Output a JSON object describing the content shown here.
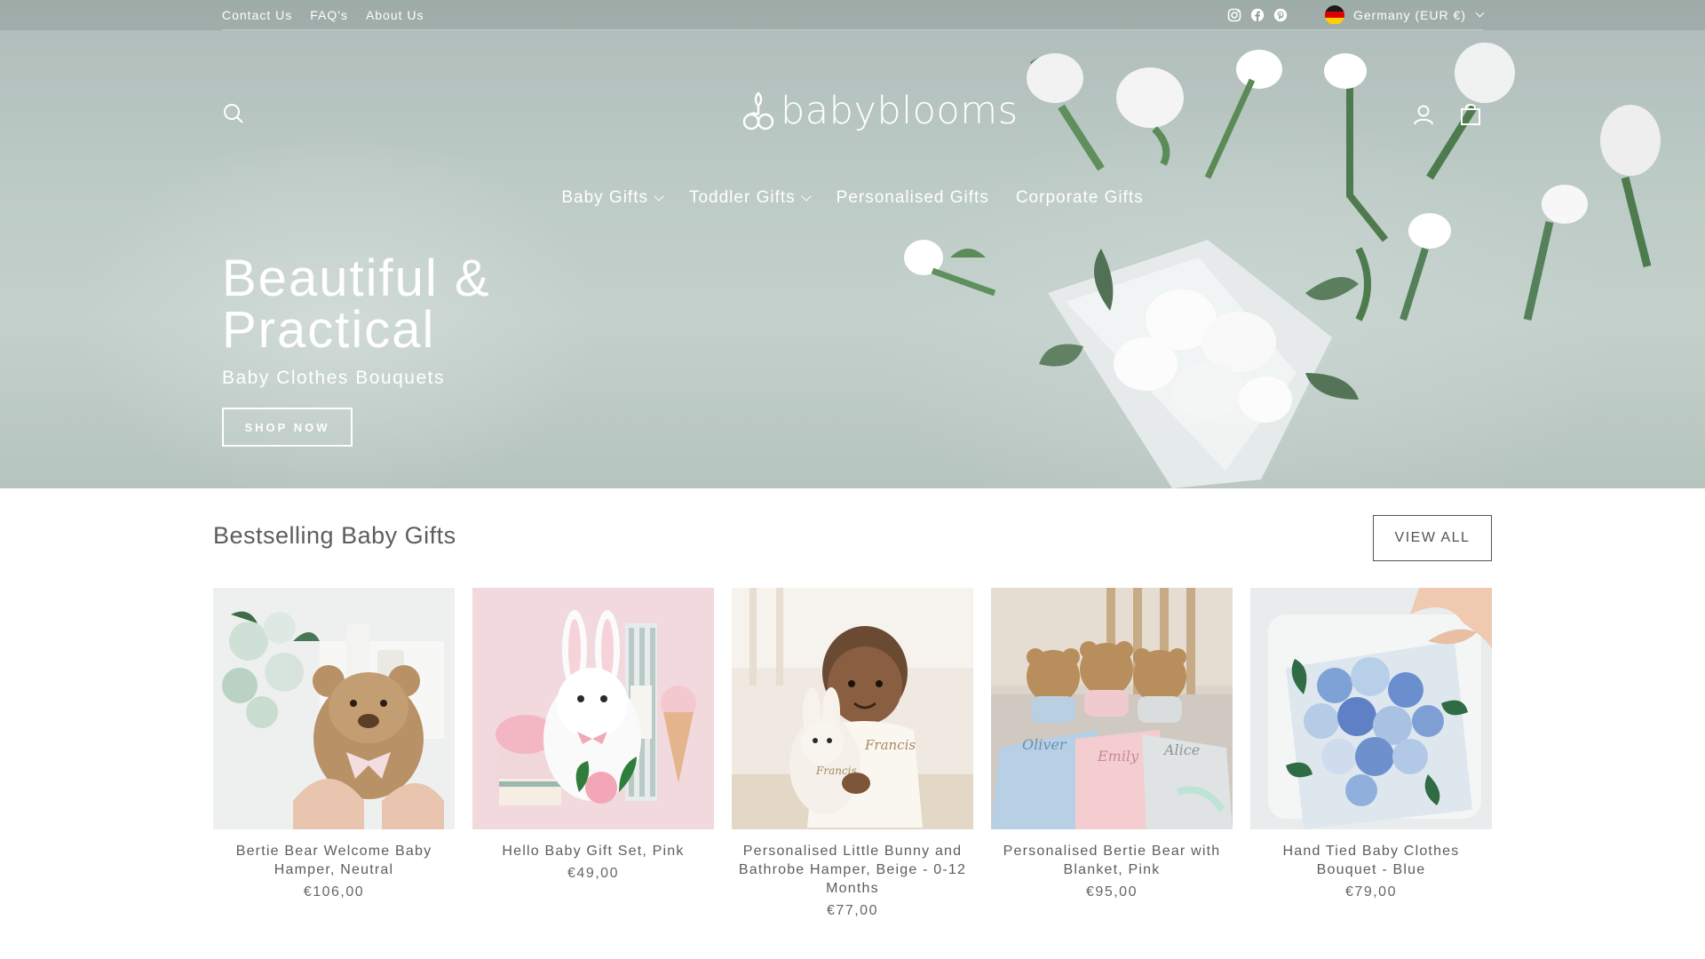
{
  "utility": {
    "links": [
      "Contact Us",
      "FAQ's",
      "About Us"
    ],
    "social": [
      "instagram-icon",
      "facebook-icon",
      "pinterest-icon"
    ],
    "currency": "Germany (EUR €)"
  },
  "header": {
    "logo_text": "babyblooms"
  },
  "nav": [
    {
      "label": "Baby Gifts",
      "dropdown": true
    },
    {
      "label": "Toddler Gifts",
      "dropdown": true
    },
    {
      "label": "Personalised Gifts",
      "dropdown": false
    },
    {
      "label": "Corporate Gifts",
      "dropdown": false
    }
  ],
  "hero": {
    "title_line1": "Beautiful &",
    "title_line2": "Practical",
    "subtitle": "Baby Clothes Bouquets",
    "cta": "SHOP NOW"
  },
  "bestsellers": {
    "title": "Bestselling Baby Gifts",
    "view_all": "VIEW ALL",
    "products": [
      {
        "name": "Bertie Bear Welcome Baby Hamper, Neutral",
        "price": "€106,00"
      },
      {
        "name": "Hello Baby Gift Set, Pink",
        "price": "€49,00"
      },
      {
        "name": "Personalised Little Bunny and Bathrobe Hamper, Beige - 0-12 Months",
        "price": "€77,00"
      },
      {
        "name": "Personalised Bertie Bear with Blanket, Pink",
        "price": "€95,00"
      },
      {
        "name": "Hand Tied Baby Clothes Bouquet - Blue",
        "price": "€79,00"
      }
    ]
  },
  "colors": {
    "hero_bg": "#bccac6",
    "text": "#5d5d5d",
    "white": "#ffffff"
  }
}
